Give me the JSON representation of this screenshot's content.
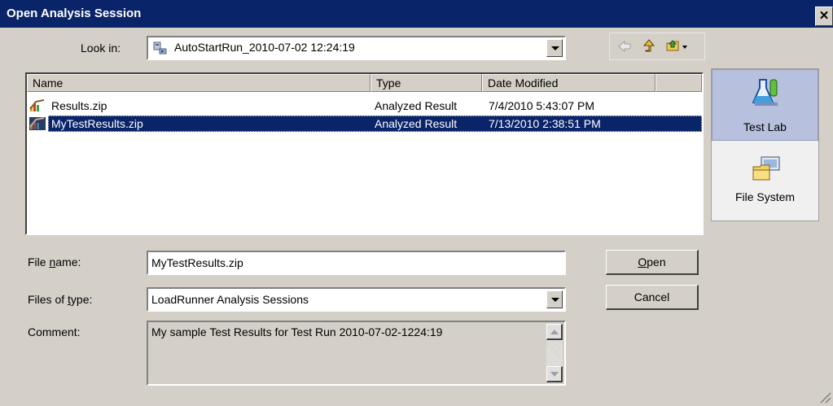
{
  "window": {
    "title": "Open Analysis Session",
    "close_glyph": "✕"
  },
  "look_in": {
    "label": "Look in:",
    "value": "AutoStartRun_2010-07-02 12:24:19"
  },
  "columns": [
    "Name",
    "Type",
    "Date Modified"
  ],
  "files": [
    {
      "name": "Results.zip",
      "type": "Analyzed Result",
      "date": "7/4/2010 5:43:07 PM",
      "selected": false
    },
    {
      "name": "MyTestResults.zip",
      "type": "Analyzed Result",
      "date": "7/13/2010 2:38:51 PM",
      "selected": true
    }
  ],
  "places": [
    {
      "label": "Test Lab",
      "icon": "flask-icon",
      "active": true
    },
    {
      "label": "File System",
      "icon": "folder-computer-icon",
      "active": false
    }
  ],
  "file_name": {
    "label_prefix": "File ",
    "label_key": "n",
    "label_suffix": "ame:",
    "value": "MyTestResults.zip"
  },
  "files_of_type": {
    "label_prefix": "Files of ",
    "label_key": "t",
    "label_suffix": "ype:",
    "value": "LoadRunner Analysis Sessions"
  },
  "comment": {
    "label": "Comment:",
    "value": "My sample Test Results for Test Run 2010-07-02-1224:19"
  },
  "buttons": {
    "open_key": "O",
    "open_rest": "pen",
    "cancel": "Cancel"
  },
  "colors": {
    "titlebar": "#0a246a",
    "dialog_bg": "#d4d0c8",
    "selection": "#0a246a",
    "places_active": "#b7c0dc"
  }
}
